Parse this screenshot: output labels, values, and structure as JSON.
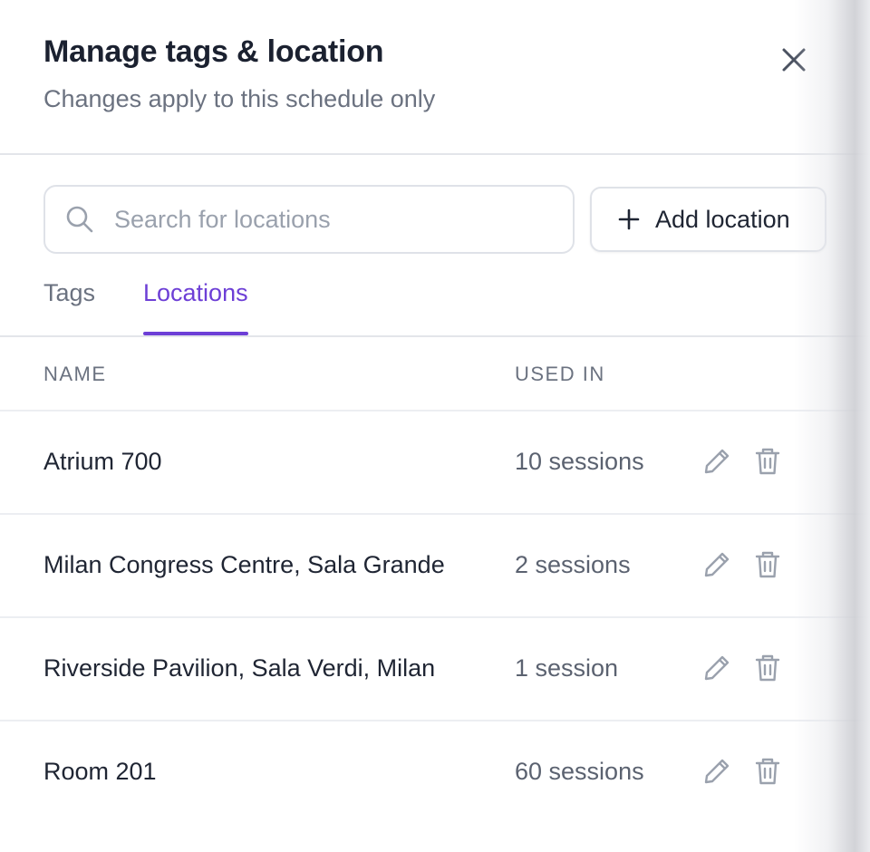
{
  "header": {
    "title": "Manage tags & location",
    "subtitle": "Changes apply to this schedule only",
    "close_icon": "close-icon"
  },
  "toolbar": {
    "search_placeholder": "Search for locations",
    "search_value": "",
    "search_icon": "search-icon",
    "add_label": "Add location",
    "add_icon": "plus-icon"
  },
  "tabs": [
    {
      "label": "Tags",
      "active": false
    },
    {
      "label": "Locations",
      "active": true
    }
  ],
  "table": {
    "columns": {
      "name": "NAME",
      "used_in": "USED IN"
    },
    "rows": [
      {
        "name": "Atrium 700",
        "used_in": "10 sessions"
      },
      {
        "name": "Milan Congress Centre, Sala Grande",
        "used_in": "2 sessions"
      },
      {
        "name": "Riverside Pavilion, Sala Verdi, Milan",
        "used_in": "1 session"
      },
      {
        "name": "Room 201",
        "used_in": "60 sessions"
      }
    ],
    "row_actions": [
      "pencil-icon",
      "trash-icon"
    ]
  },
  "colors": {
    "accent": "#6d3fd6",
    "text_primary": "#1f2533",
    "text_muted": "#6b7280",
    "border": "#dfe2e8",
    "icon": "#9aa1ad"
  }
}
